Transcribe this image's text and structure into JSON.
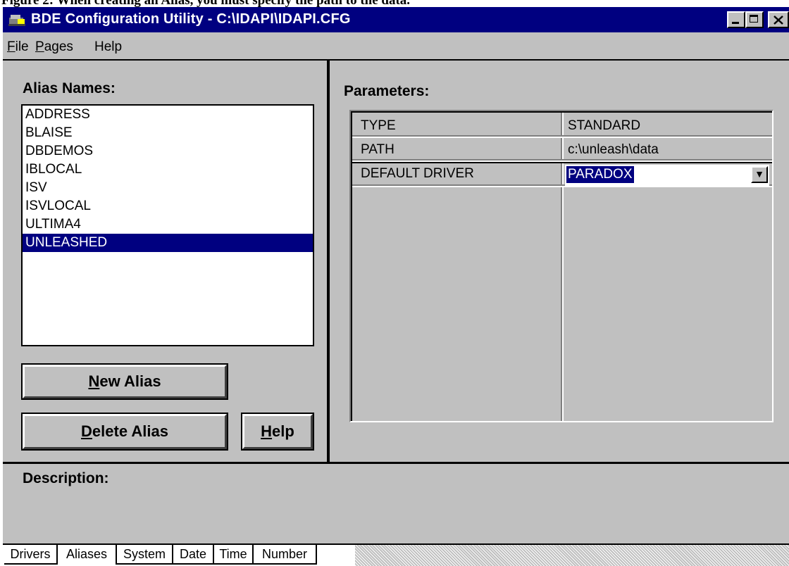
{
  "caption": "Figure 2: When creating an Alias, you must specify the path to the data.",
  "window": {
    "title": "BDE Configuration Utility - C:\\IDAPI\\IDAPI.CFG",
    "icon": "bde-app-icon",
    "controls": {
      "minimize": "minimize-icon",
      "maximize": "maximize-icon",
      "close": "close-icon"
    }
  },
  "menu": [
    {
      "acc": "F",
      "rest": "ile"
    },
    {
      "acc": "P",
      "rest": "ages"
    },
    {
      "acc": "",
      "rest": "Help"
    }
  ],
  "alias_panel": {
    "label": "Alias Names:",
    "items": [
      "ADDRESS",
      "BLAISE",
      "DBDEMOS",
      "IBLOCAL",
      "ISV",
      "ISVLOCAL",
      "ULTIMA4",
      "UNLEASHED"
    ],
    "selected": "UNLEASHED",
    "buttons": {
      "new": {
        "acc": "N",
        "rest": "ew Alias"
      },
      "delete": {
        "acc": "D",
        "rest": "elete Alias"
      },
      "help": {
        "acc": "H",
        "rest": "elp"
      }
    }
  },
  "parameters": {
    "label": "Parameters:",
    "rows": [
      {
        "name": "TYPE",
        "value": "STANDARD"
      },
      {
        "name": "PATH",
        "value": "c:\\unleash\\data"
      },
      {
        "name": "DEFAULT DRIVER",
        "value": "PARADOX"
      }
    ]
  },
  "description": {
    "label": "Description:"
  },
  "tabs": [
    "Drivers",
    "Aliases",
    "System",
    "Date",
    "Time",
    "Number"
  ],
  "active_tab": "Aliases",
  "colors": {
    "titlebar": "#000080",
    "face": "#c0c0c0",
    "selection": "#000080"
  }
}
